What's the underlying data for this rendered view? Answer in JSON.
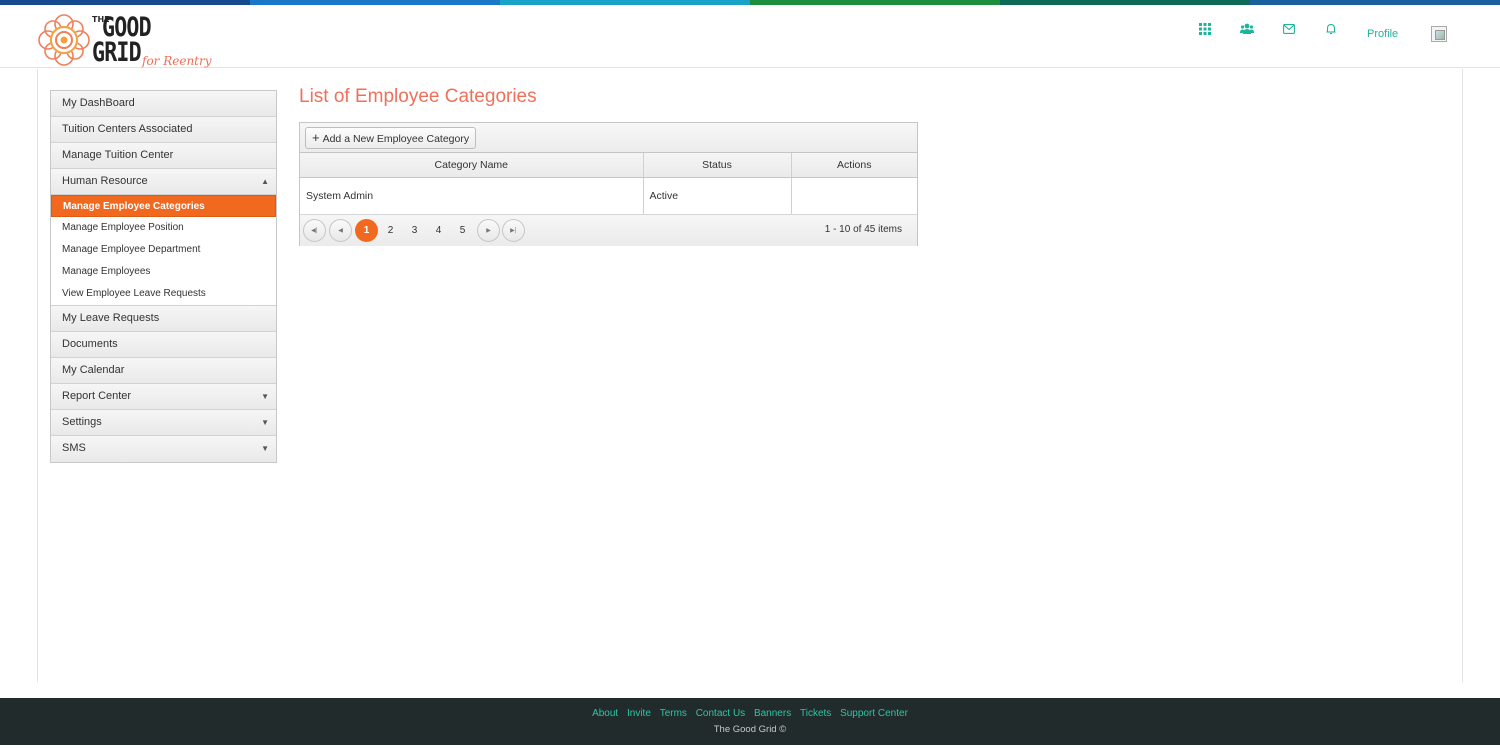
{
  "colors": {
    "strip": [
      "#154a8f",
      "#1a78c8",
      "#19a3c6",
      "#1b8f3e",
      "#0d6b55",
      "#1a5f9e"
    ],
    "accent": "#f0691f",
    "title": "#f0705a",
    "link": "#1eb39b",
    "footer_bg": "#222b2b"
  },
  "logo": {
    "the": "THE",
    "good": "GOOD",
    "grid": "GRID",
    "tagline": "for Reentry"
  },
  "header": {
    "icons": [
      "apps-grid-icon",
      "users-icon",
      "mail-icon",
      "bell-icon"
    ],
    "profile_label": "Profile"
  },
  "sidebar": {
    "items_top": [
      {
        "label": "My DashBoard"
      },
      {
        "label": "Tuition Centers Associated"
      },
      {
        "label": "Manage Tuition Center"
      }
    ],
    "hr": {
      "label": "Human Resource",
      "caret": "▲",
      "sub_items": [
        {
          "label": "Manage Employee Categories",
          "active": true
        },
        {
          "label": "Manage Employee Position"
        },
        {
          "label": "Manage Employee Department"
        },
        {
          "label": "Manage Employees"
        },
        {
          "label": "View Employee Leave Requests"
        }
      ]
    },
    "items_bottom": [
      {
        "label": "My Leave Requests",
        "caret": ""
      },
      {
        "label": "Documents",
        "caret": ""
      },
      {
        "label": "My Calendar",
        "caret": ""
      },
      {
        "label": "Report Center",
        "caret": "▼"
      },
      {
        "label": "Settings",
        "caret": "▼"
      },
      {
        "label": "SMS",
        "caret": "▼"
      }
    ]
  },
  "main": {
    "title": "List of Employee Categories",
    "add_button_label": "Add a New Employee Category",
    "columns": [
      "Category Name",
      "Status",
      "Actions"
    ],
    "rows": [
      {
        "name": "System Admin",
        "status": "Active",
        "actions": ""
      }
    ],
    "pager": {
      "pages": [
        "1",
        "2",
        "3",
        "4",
        "5"
      ],
      "current": 1,
      "info": "1 - 10 of 45 items"
    }
  },
  "footer": {
    "links": [
      "About",
      "Invite",
      "Terms",
      "Contact Us",
      "Banners",
      "Tickets",
      "Support Center"
    ],
    "copyright": "The Good Grid ©"
  }
}
